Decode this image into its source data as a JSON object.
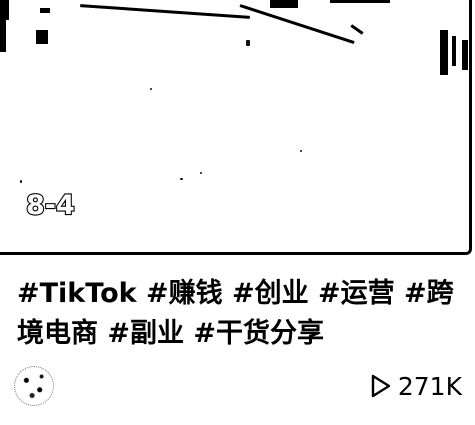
{
  "video": {
    "series_label": "8-4",
    "caption": "#TikTok #赚钱 #创业 #运营 #跨境电商 #副业 #干货分享",
    "author_name": "",
    "views": "271K"
  },
  "icons": {
    "views": "play-outline-icon",
    "avatar": "avatar"
  },
  "colors": {
    "text": "#000000",
    "background": "#ffffff"
  }
}
